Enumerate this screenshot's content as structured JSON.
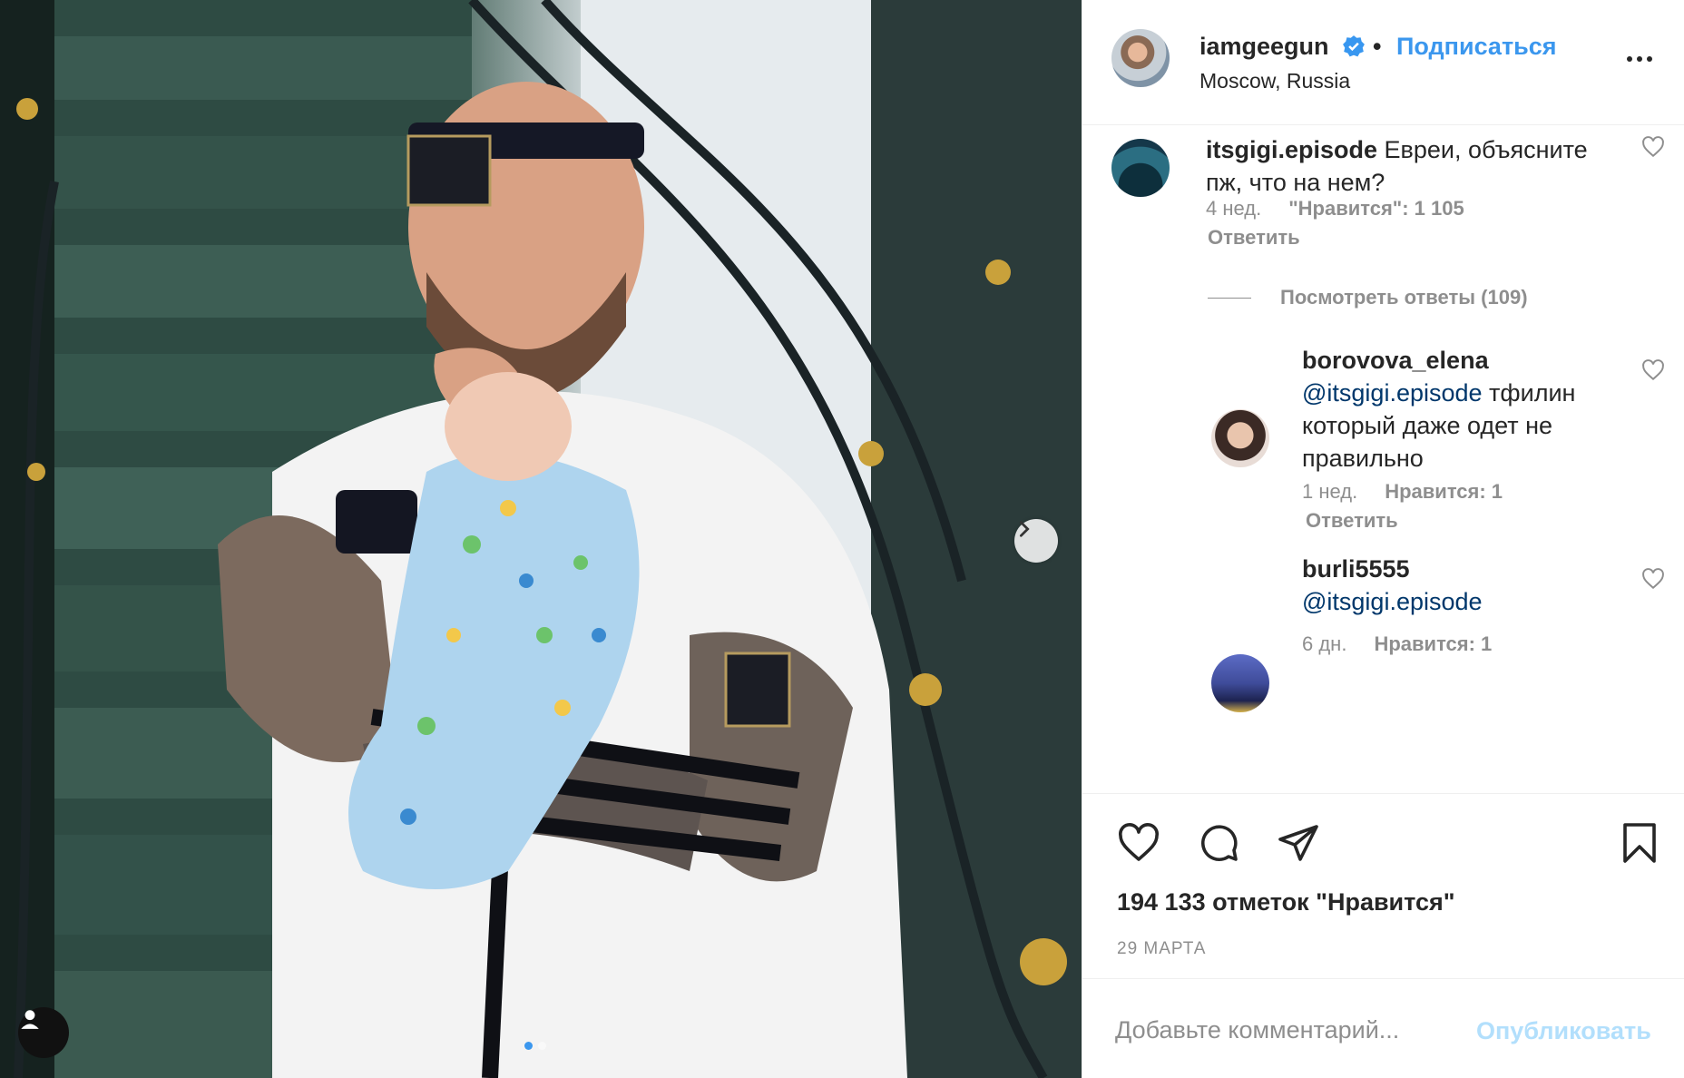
{
  "post": {
    "author": "iamgeegun",
    "follow_label": "Подписаться",
    "separator": "•",
    "location": "Moscow, Russia",
    "verified": true,
    "accent": "#3b97ee",
    "photo_description_icon": "user-tag-icon",
    "carousel": {
      "count": 2,
      "active_index": 0
    }
  },
  "comments": [
    {
      "user": "itsgigi.episode",
      "text": "Евреи, объясните пж, что на нем?",
      "age": "4 нед.",
      "likes": "\"Нравится\": 1 105",
      "reply_label": "Ответить",
      "view_replies": "Посмотреть ответы (109)"
    },
    {
      "user": "borovova_elena",
      "mention": "@itsgigi.episode",
      "text": "тфилин который даже одет не правильно",
      "age": "1 нед.",
      "likes": "Нравится: 1",
      "reply_label": "Ответить"
    },
    {
      "user": "burli5555",
      "mention": "@itsgigi.episode",
      "text": "",
      "age": "6 дн.",
      "likes": "Нравится: 1"
    }
  ],
  "actions": {
    "like_count": "194 133 отметок \"Нравится\"",
    "date": "29 МАРТА",
    "icons": [
      "heart-icon",
      "comment-icon",
      "share-icon",
      "bookmark-icon"
    ]
  },
  "add_comment": {
    "placeholder": "Добавьте комментарий...",
    "publish_label": "Опубликовать"
  }
}
